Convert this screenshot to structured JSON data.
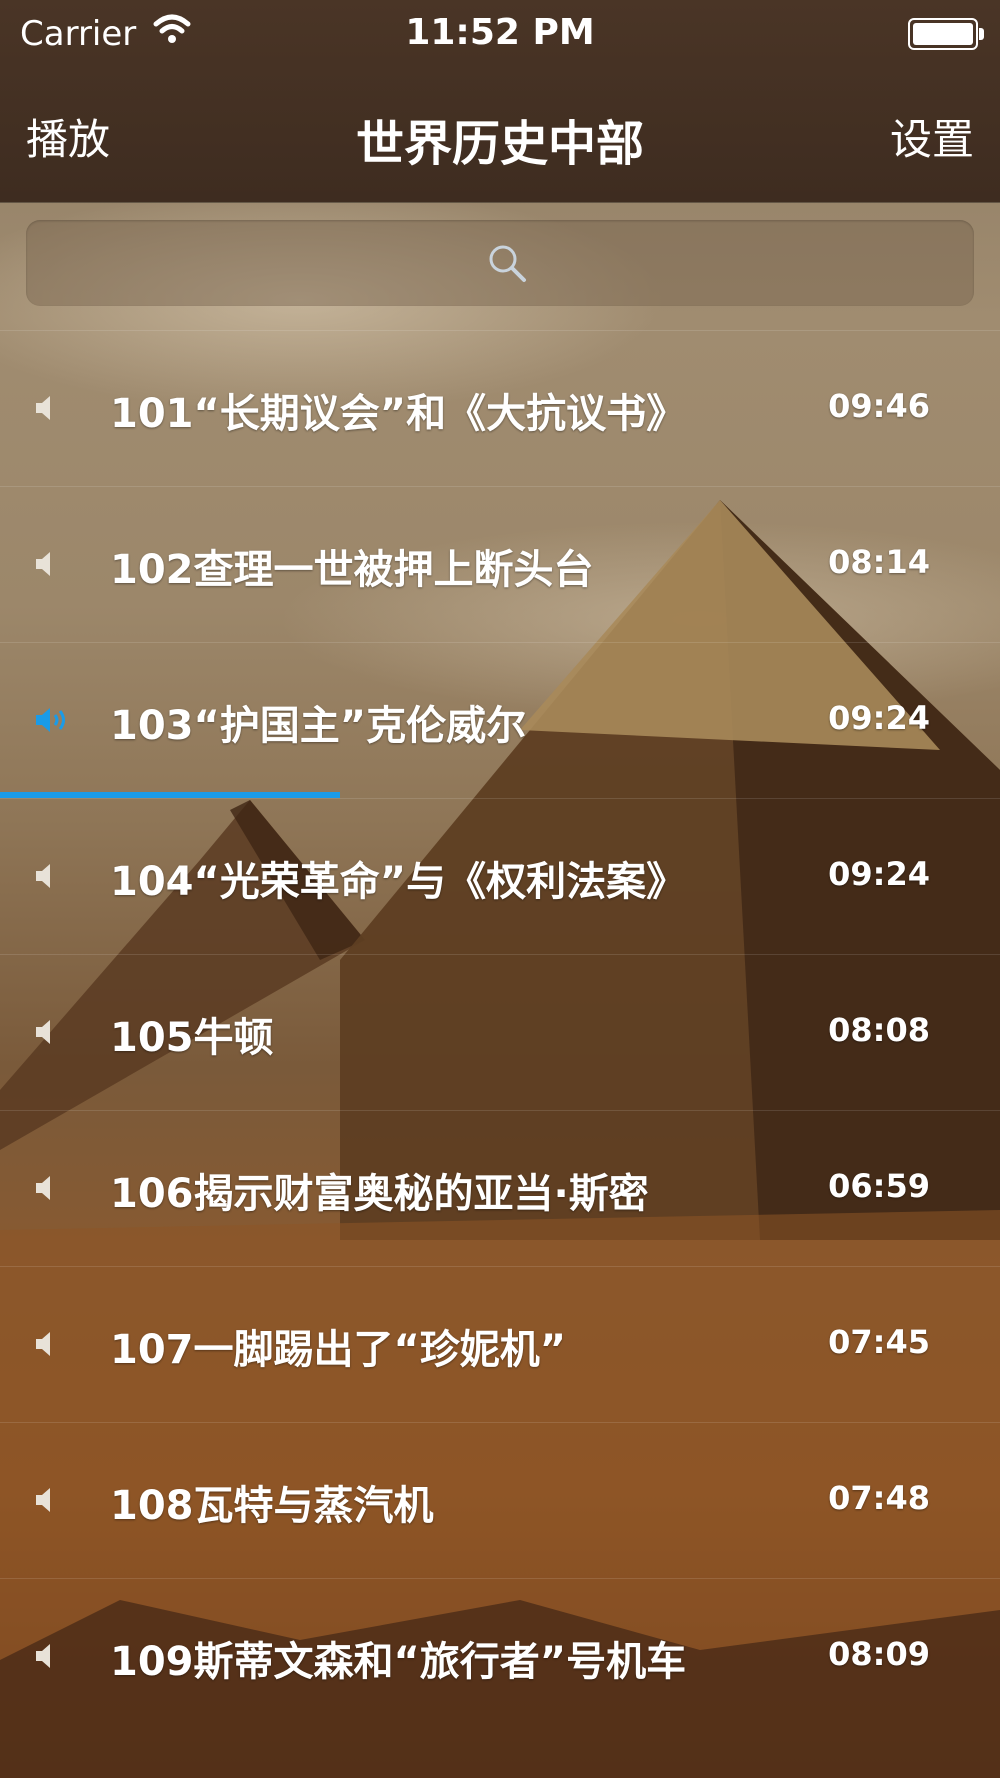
{
  "status_bar": {
    "carrier": "Carrier",
    "time": "11:52 PM"
  },
  "nav": {
    "left_label": "播放",
    "title": "世界历史中部",
    "right_label": "设置"
  },
  "search": {
    "placeholder": ""
  },
  "colors": {
    "accent": "#1a9be8",
    "nav_bg": "#3e2c20",
    "text": "#ffffff"
  },
  "tracks": [
    {
      "title": "101“长期议会”和《大抗议书》",
      "duration": "09:46",
      "playing": false
    },
    {
      "title": "102查理一世被押上断头台",
      "duration": "08:14",
      "playing": false
    },
    {
      "title": "103“护国主”克伦威尔",
      "duration": "09:24",
      "playing": true
    },
    {
      "title": "104“光荣革命”与《权利法案》",
      "duration": "09:24",
      "playing": false
    },
    {
      "title": "105牛顿",
      "duration": "08:08",
      "playing": false
    },
    {
      "title": "106揭示财富奥秘的亚当·斯密",
      "duration": "06:59",
      "playing": false
    },
    {
      "title": "107一脚踢出了“珍妮机”",
      "duration": "07:45",
      "playing": false
    },
    {
      "title": "108瓦特与蒸汽机",
      "duration": "07:48",
      "playing": false
    },
    {
      "title": "109斯蒂文森和“旅行者”号机车",
      "duration": "08:09",
      "playing": false
    }
  ],
  "playback": {
    "progress": 0.34
  }
}
